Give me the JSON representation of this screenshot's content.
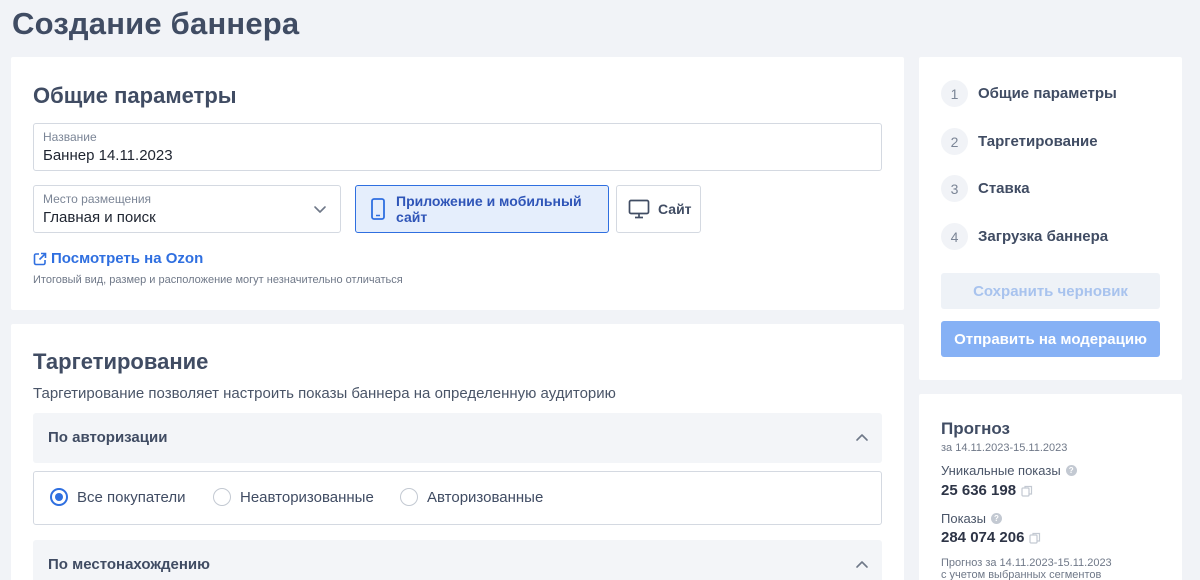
{
  "page": {
    "title": "Создание баннера"
  },
  "general": {
    "title": "Общие параметры",
    "name_label": "Название",
    "name_value": "Баннер 14.11.2023",
    "placement_label": "Место размещения",
    "placement_value": "Главная и поиск",
    "device_app": "Приложение и мобильный сайт",
    "device_site": "Сайт",
    "view_link": "Посмотреть на Ozon",
    "hint": "Итоговый вид, размер и расположение могут незначительно отличаться"
  },
  "targeting": {
    "title": "Таргетирование",
    "description": "Таргетирование позволяет настроить показы баннера на определенную аудиторию",
    "auth_section": "По авторизации",
    "options": [
      "Все покупатели",
      "Неавторизованные",
      "Авторизованные"
    ],
    "selected_option": "Все покупатели",
    "location_section": "По местонахождению"
  },
  "steps": {
    "items": [
      {
        "num": "1",
        "label": "Общие параметры"
      },
      {
        "num": "2",
        "label": "Таргетирование"
      },
      {
        "num": "3",
        "label": "Ставка"
      },
      {
        "num": "4",
        "label": "Загрузка баннера"
      }
    ],
    "save_draft": "Сохранить черновик",
    "submit": "Отправить на модерацию"
  },
  "forecast": {
    "title": "Прогноз",
    "period": "за 14.11.2023-15.11.2023",
    "unique_label": "Уникальные показы",
    "unique_value": "25 636 198",
    "shows_label": "Показы",
    "shows_value": "284 074 206",
    "footnote_line1": "Прогноз за 14.11.2023-15.11.2023",
    "footnote_line2": "с учетом выбранных сегментов"
  },
  "colors": {
    "accent": "#2f6fe0",
    "title": "#404c63",
    "background": "#f1f3f7"
  }
}
